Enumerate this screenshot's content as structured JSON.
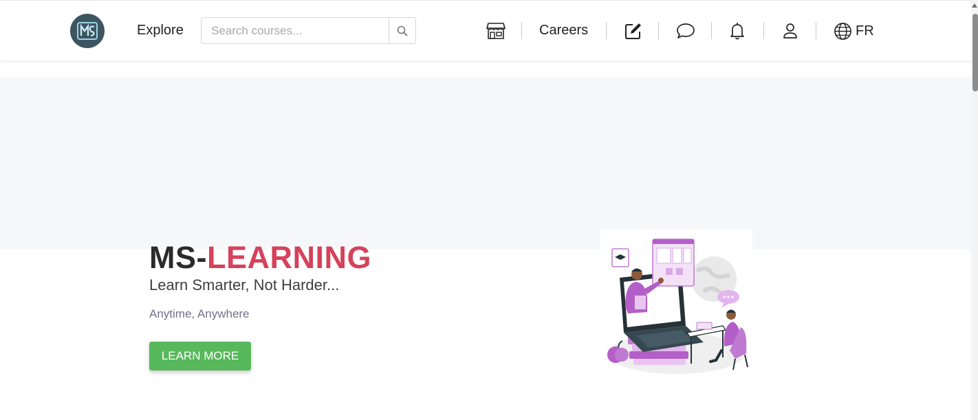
{
  "header": {
    "logo_icon": "ms-learning-logo-icon",
    "explore_label": "Explore",
    "search": {
      "placeholder": "Search courses...",
      "value": "",
      "button_icon": "search-icon"
    },
    "icons": [
      "store-icon",
      "edit-icon",
      "chat-icon",
      "bell-icon",
      "user-icon",
      "globe-icon"
    ],
    "careers_label": "Careers",
    "language_label": "FR"
  },
  "hero": {
    "title_part1": "MS-",
    "title_part2": "LEARNING",
    "subtitle": "Learn Smarter, Not Harder...",
    "tagline": "Anytime, Anywhere",
    "cta_label": "LEARN MORE",
    "illustration": "online-learning-illustration"
  },
  "colors": {
    "brand_red": "#d6425b",
    "cta_green": "#58b85c",
    "hero_band": "#f6f7f9",
    "accent_purple": "#b45fc7"
  }
}
